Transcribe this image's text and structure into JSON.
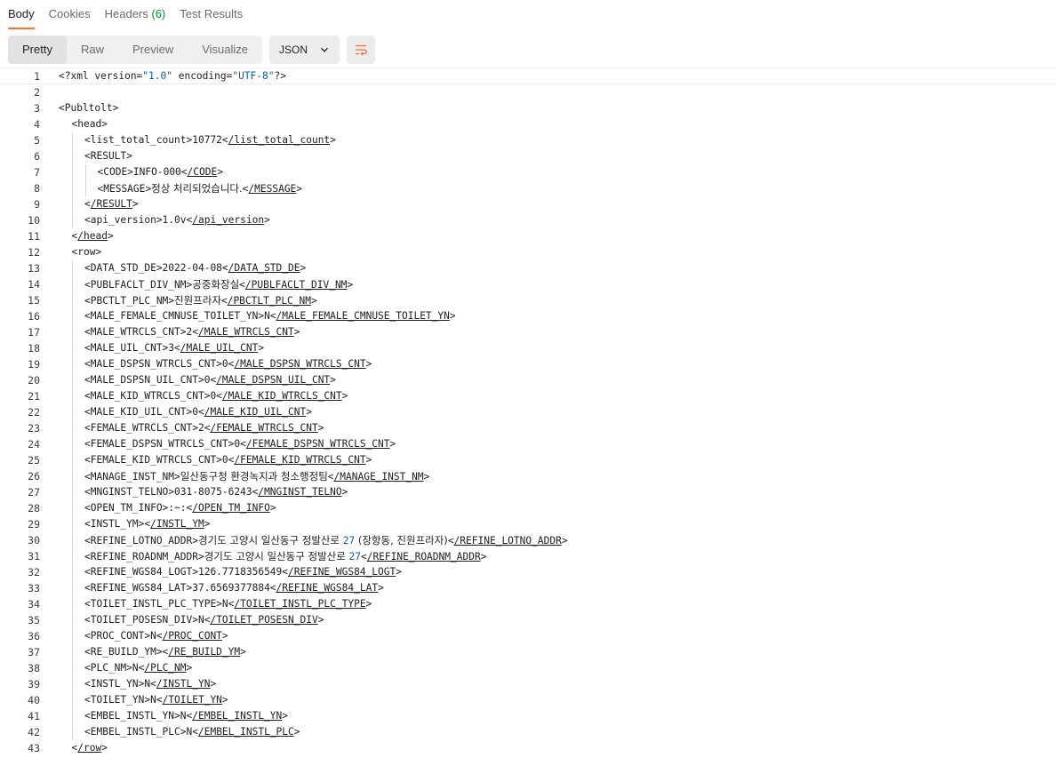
{
  "tabs": [
    {
      "label": "Body",
      "active": true
    },
    {
      "label": "Cookies",
      "active": false
    },
    {
      "label": "Headers",
      "count": "(6)",
      "active": false
    },
    {
      "label": "Test Results",
      "active": false
    }
  ],
  "view_modes": [
    "Pretty",
    "Raw",
    "Preview",
    "Visualize"
  ],
  "active_view_mode": "Pretty",
  "format_select": "JSON",
  "colors": {
    "accent": "#ff6c37",
    "count": "#0a8a3a",
    "string": "#0a5fa8"
  },
  "lines": [
    {
      "n": "1",
      "indent": 0,
      "parts": [
        [
          "t",
          "<?xml version="
        ],
        [
          "s",
          "\"1.0\""
        ],
        [
          "t",
          " encoding="
        ],
        [
          "s",
          "\"UTF-8\""
        ],
        [
          "t",
          "?>"
        ]
      ]
    },
    {
      "n": "2",
      "indent": 0,
      "parts": []
    },
    {
      "n": "3",
      "indent": 0,
      "parts": [
        [
          "t",
          "<Publtolt>"
        ]
      ]
    },
    {
      "n": "4",
      "indent": 1,
      "parts": [
        [
          "t",
          "<head>"
        ]
      ]
    },
    {
      "n": "5",
      "indent": 2,
      "parts": [
        [
          "t",
          "<list_total_count>10772<"
        ],
        [
          "u",
          "/list_total_count"
        ],
        [
          "t",
          ">"
        ]
      ]
    },
    {
      "n": "6",
      "indent": 2,
      "parts": [
        [
          "t",
          "<RESULT>"
        ]
      ]
    },
    {
      "n": "7",
      "indent": 3,
      "parts": [
        [
          "t",
          "<CODE>INFO-000<"
        ],
        [
          "u",
          "/CODE"
        ],
        [
          "t",
          ">"
        ]
      ]
    },
    {
      "n": "8",
      "indent": 3,
      "parts": [
        [
          "t",
          "<MESSAGE>"
        ],
        [
          "k",
          "정상 처리되었습니다."
        ],
        [
          "t",
          "<"
        ],
        [
          "u",
          "/MESSAGE"
        ],
        [
          "t",
          ">"
        ]
      ]
    },
    {
      "n": "9",
      "indent": 2,
      "parts": [
        [
          "t",
          "<"
        ],
        [
          "u",
          "/RESULT"
        ],
        [
          "t",
          ">"
        ]
      ]
    },
    {
      "n": "10",
      "indent": 2,
      "parts": [
        [
          "t",
          "<api_version>1.0v<"
        ],
        [
          "u",
          "/api_version"
        ],
        [
          "t",
          ">"
        ]
      ]
    },
    {
      "n": "11",
      "indent": 1,
      "parts": [
        [
          "t",
          "<"
        ],
        [
          "u",
          "/head"
        ],
        [
          "t",
          ">"
        ]
      ]
    },
    {
      "n": "12",
      "indent": 1,
      "parts": [
        [
          "t",
          "<row>"
        ]
      ]
    },
    {
      "n": "13",
      "indent": 2,
      "parts": [
        [
          "t",
          "<DATA_STD_DE>2022-04-08<"
        ],
        [
          "u",
          "/DATA_STD_DE"
        ],
        [
          "t",
          ">"
        ]
      ]
    },
    {
      "n": "14",
      "indent": 2,
      "parts": [
        [
          "t",
          "<PUBLFACLT_DIV_NM>"
        ],
        [
          "k",
          "공중화장실"
        ],
        [
          "t",
          "<"
        ],
        [
          "u",
          "/PUBLFACLT_DIV_NM"
        ],
        [
          "t",
          ">"
        ]
      ]
    },
    {
      "n": "15",
      "indent": 2,
      "parts": [
        [
          "t",
          "<PBCTLT_PLC_NM>"
        ],
        [
          "k",
          "진원프라자"
        ],
        [
          "t",
          "<"
        ],
        [
          "u",
          "/PBCTLT_PLC_NM"
        ],
        [
          "t",
          ">"
        ]
      ]
    },
    {
      "n": "16",
      "indent": 2,
      "parts": [
        [
          "t",
          "<MALE_FEMALE_CMNUSE_TOILET_YN>N<"
        ],
        [
          "u",
          "/MALE_FEMALE_CMNUSE_TOILET_YN"
        ],
        [
          "t",
          ">"
        ]
      ]
    },
    {
      "n": "17",
      "indent": 2,
      "parts": [
        [
          "t",
          "<MALE_WTRCLS_CNT>2<"
        ],
        [
          "u",
          "/MALE_WTRCLS_CNT"
        ],
        [
          "t",
          ">"
        ]
      ]
    },
    {
      "n": "18",
      "indent": 2,
      "parts": [
        [
          "t",
          "<MALE_UIL_CNT>3<"
        ],
        [
          "u",
          "/MALE_UIL_CNT"
        ],
        [
          "t",
          ">"
        ]
      ]
    },
    {
      "n": "19",
      "indent": 2,
      "parts": [
        [
          "t",
          "<MALE_DSPSN_WTRCLS_CNT>0<"
        ],
        [
          "u",
          "/MALE_DSPSN_WTRCLS_CNT"
        ],
        [
          "t",
          ">"
        ]
      ]
    },
    {
      "n": "20",
      "indent": 2,
      "parts": [
        [
          "t",
          "<MALE_DSPSN_UIL_CNT>0<"
        ],
        [
          "u",
          "/MALE_DSPSN_UIL_CNT"
        ],
        [
          "t",
          ">"
        ]
      ]
    },
    {
      "n": "21",
      "indent": 2,
      "parts": [
        [
          "t",
          "<MALE_KID_WTRCLS_CNT>0<"
        ],
        [
          "u",
          "/MALE_KID_WTRCLS_CNT"
        ],
        [
          "t",
          ">"
        ]
      ]
    },
    {
      "n": "22",
      "indent": 2,
      "parts": [
        [
          "t",
          "<MALE_KID_UIL_CNT>0<"
        ],
        [
          "u",
          "/MALE_KID_UIL_CNT"
        ],
        [
          "t",
          ">"
        ]
      ]
    },
    {
      "n": "23",
      "indent": 2,
      "parts": [
        [
          "t",
          "<FEMALE_WTRCLS_CNT>2<"
        ],
        [
          "u",
          "/FEMALE_WTRCLS_CNT"
        ],
        [
          "t",
          ">"
        ]
      ]
    },
    {
      "n": "24",
      "indent": 2,
      "parts": [
        [
          "t",
          "<FEMALE_DSPSN_WTRCLS_CNT>0<"
        ],
        [
          "u",
          "/FEMALE_DSPSN_WTRCLS_CNT"
        ],
        [
          "t",
          ">"
        ]
      ]
    },
    {
      "n": "25",
      "indent": 2,
      "parts": [
        [
          "t",
          "<FEMALE_KID_WTRCLS_CNT>0<"
        ],
        [
          "u",
          "/FEMALE_KID_WTRCLS_CNT"
        ],
        [
          "t",
          ">"
        ]
      ]
    },
    {
      "n": "26",
      "indent": 2,
      "parts": [
        [
          "t",
          "<MANAGE_INST_NM>"
        ],
        [
          "k",
          "일산동구청 환경녹지과 청소행정팀"
        ],
        [
          "t",
          "<"
        ],
        [
          "u",
          "/MANAGE_INST_NM"
        ],
        [
          "t",
          ">"
        ]
      ]
    },
    {
      "n": "27",
      "indent": 2,
      "parts": [
        [
          "t",
          "<MNGINST_TELNO>031-8075-6243<"
        ],
        [
          "u",
          "/MNGINST_TELNO"
        ],
        [
          "t",
          ">"
        ]
      ]
    },
    {
      "n": "28",
      "indent": 2,
      "parts": [
        [
          "t",
          "<OPEN_TM_INFO>:~:<"
        ],
        [
          "u",
          "/OPEN_TM_INFO"
        ],
        [
          "t",
          ">"
        ]
      ]
    },
    {
      "n": "29",
      "indent": 2,
      "parts": [
        [
          "t",
          "<INSTL_YM><"
        ],
        [
          "u",
          "/INSTL_YM"
        ],
        [
          "t",
          ">"
        ]
      ]
    },
    {
      "n": "30",
      "indent": 2,
      "parts": [
        [
          "t",
          "<REFINE_LOTNO_ADDR>"
        ],
        [
          "k",
          "경기도 고양시 일산동구 정발산로 "
        ],
        [
          "s",
          "27"
        ],
        [
          "k",
          " (장항동, 진원프라자)"
        ],
        [
          "t",
          "<"
        ],
        [
          "u",
          "/REFINE_LOTNO_ADDR"
        ],
        [
          "t",
          ">"
        ]
      ]
    },
    {
      "n": "31",
      "indent": 2,
      "parts": [
        [
          "t",
          "<REFINE_ROADNM_ADDR>"
        ],
        [
          "k",
          "경기도 고양시 일산동구 정발산로 "
        ],
        [
          "s",
          "27"
        ],
        [
          "t",
          "<"
        ],
        [
          "u",
          "/REFINE_ROADNM_ADDR"
        ],
        [
          "t",
          ">"
        ]
      ]
    },
    {
      "n": "32",
      "indent": 2,
      "parts": [
        [
          "t",
          "<REFINE_WGS84_LOGT>126.7718356549<"
        ],
        [
          "u",
          "/REFINE_WGS84_LOGT"
        ],
        [
          "t",
          ">"
        ]
      ]
    },
    {
      "n": "33",
      "indent": 2,
      "parts": [
        [
          "t",
          "<REFINE_WGS84_LAT>37.6569377884<"
        ],
        [
          "u",
          "/REFINE_WGS84_LAT"
        ],
        [
          "t",
          ">"
        ]
      ]
    },
    {
      "n": "34",
      "indent": 2,
      "parts": [
        [
          "t",
          "<TOILET_INSTL_PLC_TYPE>N<"
        ],
        [
          "u",
          "/TOILET_INSTL_PLC_TYPE"
        ],
        [
          "t",
          ">"
        ]
      ]
    },
    {
      "n": "35",
      "indent": 2,
      "parts": [
        [
          "t",
          "<TOILET_POSESN_DIV>N<"
        ],
        [
          "u",
          "/TOILET_POSESN_DIV"
        ],
        [
          "t",
          ">"
        ]
      ]
    },
    {
      "n": "36",
      "indent": 2,
      "parts": [
        [
          "t",
          "<PROC_CONT>N<"
        ],
        [
          "u",
          "/PROC_CONT"
        ],
        [
          "t",
          ">"
        ]
      ]
    },
    {
      "n": "37",
      "indent": 2,
      "parts": [
        [
          "t",
          "<RE_BUILD_YM><"
        ],
        [
          "u",
          "/RE_BUILD_YM"
        ],
        [
          "t",
          ">"
        ]
      ]
    },
    {
      "n": "38",
      "indent": 2,
      "parts": [
        [
          "t",
          "<PLC_NM>N<"
        ],
        [
          "u",
          "/PLC_NM"
        ],
        [
          "t",
          ">"
        ]
      ]
    },
    {
      "n": "39",
      "indent": 2,
      "parts": [
        [
          "t",
          "<INSTL_YN>N<"
        ],
        [
          "u",
          "/INSTL_YN"
        ],
        [
          "t",
          ">"
        ]
      ]
    },
    {
      "n": "40",
      "indent": 2,
      "parts": [
        [
          "t",
          "<TOILET_YN>N<"
        ],
        [
          "u",
          "/TOILET_YN"
        ],
        [
          "t",
          ">"
        ]
      ]
    },
    {
      "n": "41",
      "indent": 2,
      "parts": [
        [
          "t",
          "<EMBEL_INSTL_YN>N<"
        ],
        [
          "u",
          "/EMBEL_INSTL_YN"
        ],
        [
          "t",
          ">"
        ]
      ]
    },
    {
      "n": "42",
      "indent": 2,
      "parts": [
        [
          "t",
          "<EMBEL_INSTL_PLC>N<"
        ],
        [
          "u",
          "/EMBEL_INSTL_PLC"
        ],
        [
          "t",
          ">"
        ]
      ]
    },
    {
      "n": "43",
      "indent": 1,
      "parts": [
        [
          "t",
          "<"
        ],
        [
          "u",
          "/row"
        ],
        [
          "t",
          ">"
        ]
      ]
    }
  ]
}
